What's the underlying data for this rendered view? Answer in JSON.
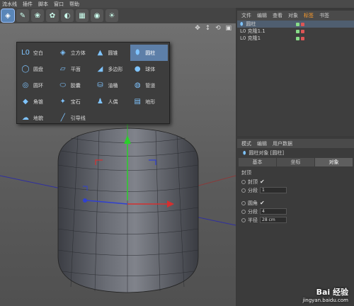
{
  "menubar": {
    "items": [
      "流水线",
      "插件",
      "脚本",
      "窗口",
      "帮助"
    ]
  },
  "popup": {
    "items": [
      {
        "icon": "null-icon",
        "glyph": "L0",
        "label": "空白"
      },
      {
        "icon": "cube-icon",
        "glyph": "◈",
        "label": "立方体"
      },
      {
        "icon": "cone-icon",
        "glyph": "▲",
        "label": "圆锥"
      },
      {
        "icon": "cylinder-icon",
        "glyph": "⬮",
        "label": "圆柱"
      },
      {
        "icon": "disc-icon",
        "glyph": "◯",
        "label": "圆盘"
      },
      {
        "icon": "plane-icon",
        "glyph": "▱",
        "label": "平面"
      },
      {
        "icon": "polygon-icon",
        "glyph": "◢",
        "label": "多边形"
      },
      {
        "icon": "sphere-icon",
        "glyph": "●",
        "label": "球体"
      },
      {
        "icon": "torus-icon",
        "glyph": "◎",
        "label": "圆环"
      },
      {
        "icon": "capsule-icon",
        "glyph": "⬭",
        "label": "胶囊"
      },
      {
        "icon": "oiltank-icon",
        "glyph": "⛁",
        "label": "油桶"
      },
      {
        "icon": "tube-icon",
        "glyph": "◍",
        "label": "管道"
      },
      {
        "icon": "pyramid-icon",
        "glyph": "◆",
        "label": "角锥"
      },
      {
        "icon": "platonic-icon",
        "glyph": "✦",
        "label": "宝石"
      },
      {
        "icon": "figure-icon",
        "glyph": "♟",
        "label": "人偶"
      },
      {
        "icon": "landscape-icon",
        "glyph": "▤",
        "label": "地形"
      },
      {
        "icon": "relief-icon",
        "glyph": "☁",
        "label": "地貌"
      },
      {
        "icon": "guide-icon",
        "glyph": "╱",
        "label": "引导线"
      }
    ],
    "selected": 3
  },
  "viewport": {
    "header_icons": "✥ ↕ ⟲ ▣"
  },
  "object_panel": {
    "tabs": [
      "文件",
      "编辑",
      "查看",
      "对象",
      "标签",
      "书签"
    ],
    "active_tab": 4,
    "rows": [
      {
        "label": "圆柱",
        "selected": true
      },
      {
        "label": "L0 克隆1.1",
        "selected": false
      },
      {
        "label": "L0 克隆1",
        "selected": false
      }
    ]
  },
  "attr_panel": {
    "tabs": [
      "模式",
      "编辑",
      "用户数据"
    ],
    "title": "圆柱对象 [圆柱]",
    "sub_tabs": [
      "基本",
      "坐标",
      "对象"
    ],
    "section": "封顶",
    "rows": [
      {
        "label": "封顶",
        "check": "✔"
      },
      {
        "label": "分段",
        "value": "1"
      },
      {
        "label": "圆角",
        "check": "✔"
      },
      {
        "label": "分段",
        "value": "4"
      },
      {
        "label": "半径",
        "value": "28 cm"
      }
    ]
  },
  "watermark": {
    "logo": "Bai 经验",
    "url": "jingyan.baidu.com"
  },
  "colors": {
    "accent": "#5d7fa8",
    "active_tab": "#ff9c2a"
  }
}
